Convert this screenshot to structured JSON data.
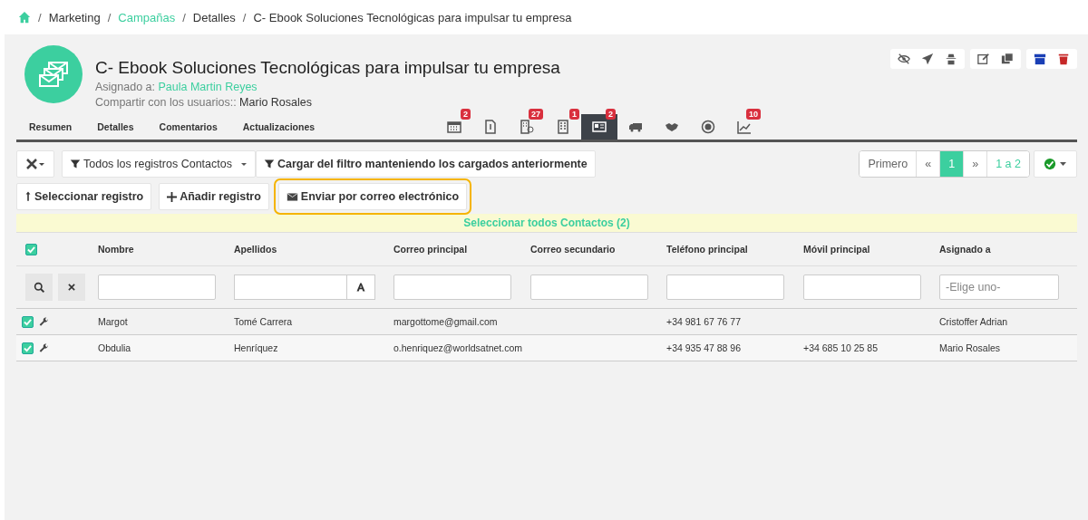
{
  "breadcrumb": [
    {
      "separator": "/",
      "label": "Marketing",
      "link": false
    },
    {
      "separator": "/",
      "label": "Campañas",
      "link": true
    },
    {
      "separator": "/",
      "label": "Detalles",
      "link": false
    },
    {
      "separator": "/",
      "label": "C- Ebook Soluciones Tecnológicas para impulsar tu empresa",
      "link": false
    }
  ],
  "record": {
    "title": "C- Ebook Soluciones Tecnológicas para impulsar tu empresa",
    "assigned_label": "Asignado a:",
    "assigned_to": "Paula Martin Reyes",
    "share_label": "Compartir con los usuarios::",
    "shared_with": "Mario Rosales"
  },
  "text_tabs": [
    {
      "label": "Resumen",
      "selected": false
    },
    {
      "label": "Detalles",
      "selected": false
    },
    {
      "label": "Comentarios",
      "selected": false
    },
    {
      "label": "Actualizaciones",
      "selected": false
    }
  ],
  "icon_tabs": [
    {
      "kind": "calendar",
      "badge": "2",
      "selected": false
    },
    {
      "kind": "document",
      "selected": false
    },
    {
      "kind": "building-clock",
      "badge": "27",
      "selected": false
    },
    {
      "kind": "building",
      "badge": "1",
      "selected": false
    },
    {
      "kind": "card",
      "badge": "2",
      "selected": true
    },
    {
      "kind": "truck",
      "selected": false
    },
    {
      "kind": "handshake",
      "selected": false
    },
    {
      "kind": "target",
      "selected": false
    },
    {
      "kind": "chart",
      "badge": "10",
      "selected": false
    }
  ],
  "toolbar": {
    "filter": "Todos los registros Contactos",
    "load_filter": "Cargar del filtro manteniendo los cargados anteriormente",
    "select": "Seleccionar registro",
    "add": "Añadir registro",
    "email": "Enviar por correo electrónico"
  },
  "pagination": [
    {
      "label": "Primero",
      "selected": false
    },
    {
      "label": "«",
      "selected": false
    },
    {
      "label": "1",
      "selected": true
    },
    {
      "label": "»",
      "selected": false
    },
    {
      "label": "1 a 2",
      "selected": false
    }
  ],
  "select_all": "Seleccionar todos Contactos (2)",
  "table": {
    "all_checked": true,
    "columns": [
      "Nombre",
      "Apellidos",
      "Correo principal",
      "Correo secundario",
      "Teléfono principal",
      "Móvil principal",
      "Asignado a"
    ],
    "assigned_placeholder": "-Elige uno-",
    "rows": [
      {
        "checked": true,
        "cells": [
          "Margot",
          "Tomé Carrera",
          "margottome@gmail.com",
          "",
          "+34 981 67 76 77",
          "",
          "Cristoffer Adrian"
        ]
      },
      {
        "checked": true,
        "cells": [
          "Obdulia",
          "Henríquez",
          "o.henriquez@worldsatnet.com",
          "",
          "+34 935 47 88 96",
          "+34 685 10 25 85",
          "Mario Rosales"
        ]
      }
    ]
  }
}
